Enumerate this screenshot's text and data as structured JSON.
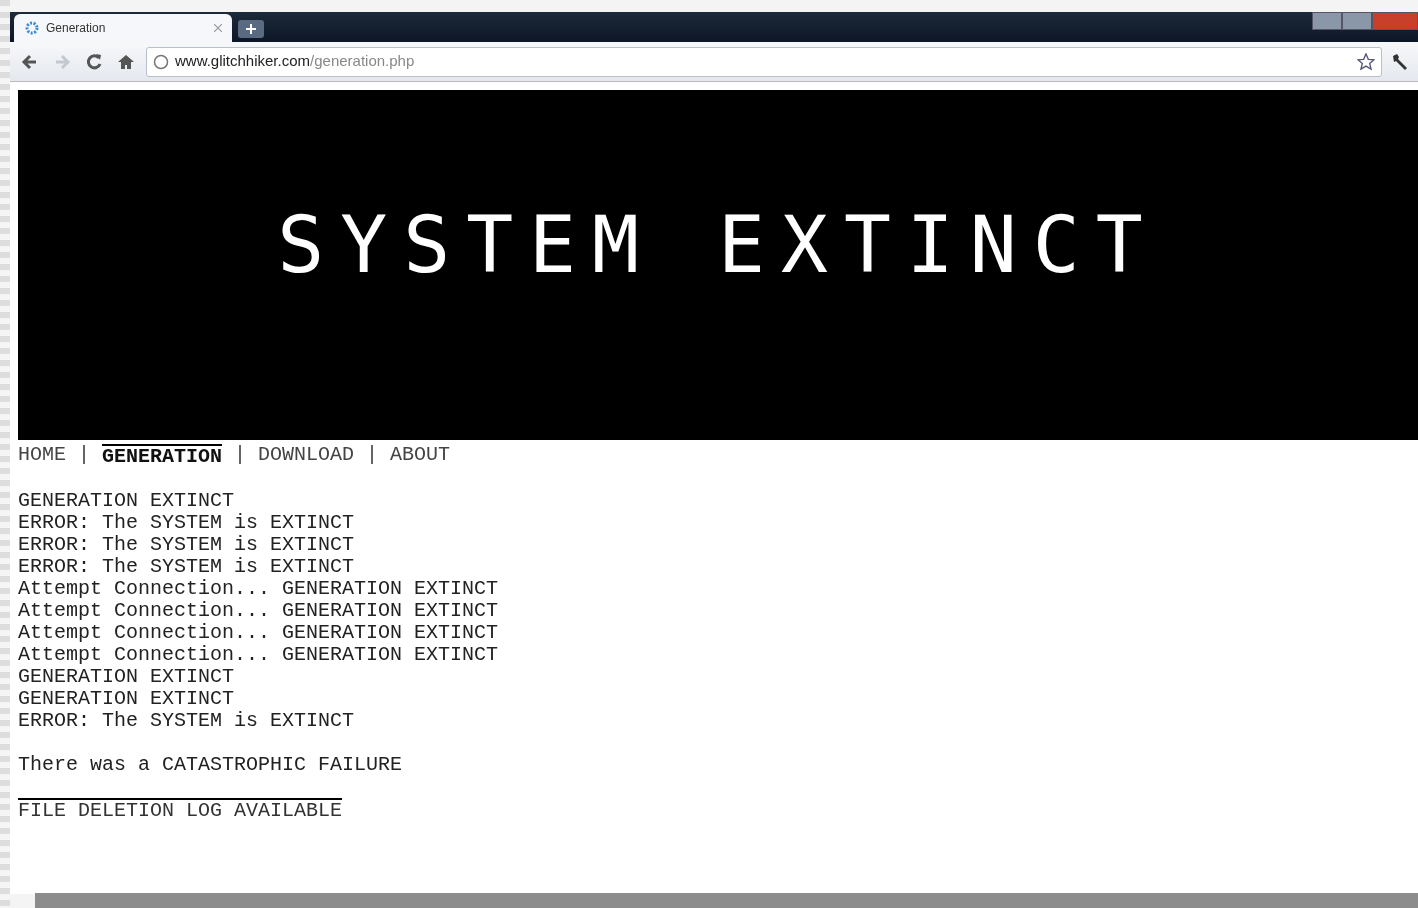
{
  "tab": {
    "title": "Generation",
    "selected": true
  },
  "address": {
    "host": "www.glitchhiker.com",
    "path": "/generation.php"
  },
  "nav_buttons": [
    {
      "kind": "back",
      "disabled": false
    },
    {
      "kind": "forward",
      "disabled": true
    },
    {
      "kind": "reload",
      "disabled": false
    },
    {
      "kind": "home",
      "disabled": false
    }
  ],
  "banner": {
    "title": "SYSTEM EXTINCT"
  },
  "menu": [
    {
      "label": "HOME",
      "selected": false
    },
    {
      "label": "GENERATION",
      "selected": true
    },
    {
      "label": "DOWNLOAD",
      "selected": false
    },
    {
      "label": "ABOUT",
      "selected": false
    }
  ],
  "menu_separator": "|",
  "log_lines": [
    "GENERATION EXTINCT",
    "ERROR: The SYSTEM is EXTINCT",
    "ERROR: The SYSTEM is EXTINCT",
    "ERROR: The SYSTEM is EXTINCT",
    "Attempt Connection... GENERATION EXTINCT",
    "Attempt Connection... GENERATION EXTINCT",
    "Attempt Connection... GENERATION EXTINCT",
    "Attempt Connection... GENERATION EXTINCT",
    "GENERATION EXTINCT",
    "GENERATION EXTINCT",
    "ERROR: The SYSTEM is EXTINCT"
  ],
  "failure_message": "There was a CATASTROPHIC FAILURE",
  "log_link": "FILE DELETION LOG AVAILABLE"
}
